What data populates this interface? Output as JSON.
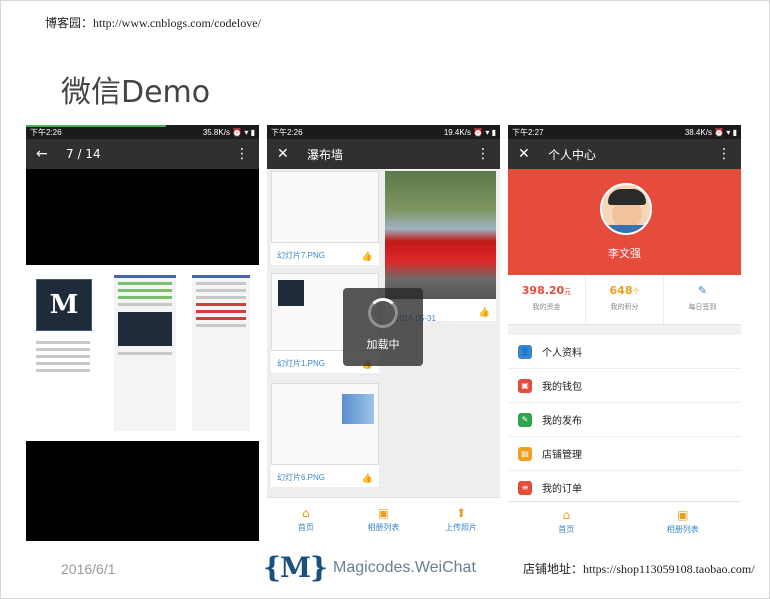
{
  "blog_note": "博客园：http://www.cnblogs.com/codelove/",
  "slide_title": "微信Demo",
  "date": "2016/6/1",
  "brand": {
    "logo": "{M}",
    "name": "Magicodes.WeiChat"
  },
  "shop_note": "店铺地址：https://shop113059108.taobao.com/",
  "phone1": {
    "status": {
      "time": "下午2:26",
      "right": "35.8K/s ⏰ ▾ ▮"
    },
    "appbar": {
      "back_icon": "←",
      "title": "7 / 14",
      "more_icon": "⋮"
    },
    "mini_logo": "M"
  },
  "phone2": {
    "status": {
      "time": "下午2:26",
      "right": "19.4K/s ⏰ ▾ ▮"
    },
    "appbar": {
      "close_icon": "✕",
      "title": "瀑布墙",
      "more_icon": "⋮"
    },
    "cards": [
      {
        "caption": "幻灯片7.PNG"
      },
      {
        "caption": "幻灯片1.PNG"
      },
      {
        "caption": "幻灯片6.PNG"
      },
      {
        "caption": "2016-05-31"
      }
    ],
    "loading": "加载中",
    "tabs": [
      {
        "icon": "⌂",
        "label": "首页"
      },
      {
        "icon": "▣",
        "label": "相册列表"
      },
      {
        "icon": "⬆",
        "label": "上传照片"
      }
    ]
  },
  "phone3": {
    "status": {
      "time": "下午2:27",
      "right": "38.4K/s ⏰ ▾ ▮"
    },
    "appbar": {
      "close_icon": "✕",
      "title": "个人中心",
      "more_icon": "⋮"
    },
    "user_name": "李文强",
    "stats": [
      {
        "value": "398.20",
        "unit": "元",
        "label": "我的资金",
        "color": "#e64c3c"
      },
      {
        "value": "648",
        "unit": "个",
        "label": "我的积分",
        "color": "#f0a020"
      },
      {
        "value": "✎",
        "unit": "",
        "label": "每日签到",
        "color": "#3a86c8"
      }
    ],
    "menu": [
      {
        "label": "个人资料",
        "icon": "person-icon",
        "color": "#3a86c8",
        "glyph": "👤"
      },
      {
        "label": "我的钱包",
        "icon": "wallet-icon",
        "color": "#e64c3c",
        "glyph": "▣"
      },
      {
        "label": "我的发布",
        "icon": "edit-icon",
        "color": "#2ea44f",
        "glyph": "✎"
      },
      {
        "label": "店铺管理",
        "icon": "store-icon",
        "color": "#f0a020",
        "glyph": "▤"
      },
      {
        "label": "我的订单",
        "icon": "order-icon",
        "color": "#e64c3c",
        "glyph": "≡"
      }
    ],
    "tabs": [
      {
        "icon": "⌂",
        "label": "首页"
      },
      {
        "icon": "▣",
        "label": "相册列表"
      }
    ]
  }
}
